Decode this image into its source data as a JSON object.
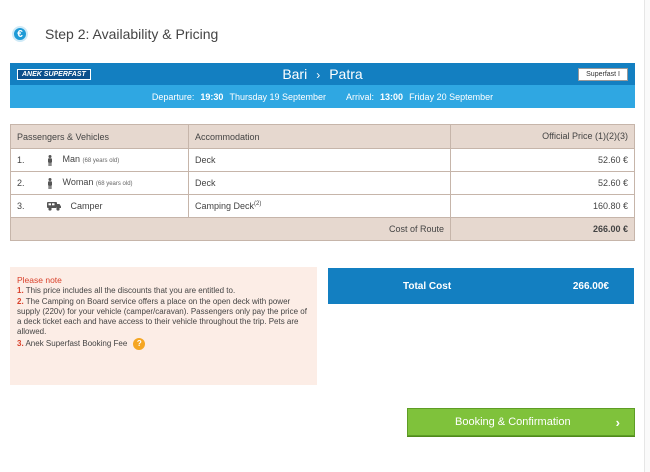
{
  "step": {
    "badge_icon": "euro-icon",
    "badge_symbol": "€",
    "title": "Step 2: Availability & Pricing"
  },
  "route": {
    "operator_logo": "ANEK SUPERFAST",
    "from": "Bari",
    "arrow": "›",
    "to": "Patra",
    "vessel": "Superfast I",
    "departure_label": "Departure:",
    "departure_time": "19:30",
    "departure_date": "Thursday 19 September",
    "arrival_label": "Arrival:",
    "arrival_time": "13:00",
    "arrival_date": "Friday 20 September"
  },
  "table": {
    "headers": {
      "passengers": "Passengers & Vehicles",
      "accommodation": "Accommodation",
      "price": "Official Price (1)(2)(3)"
    },
    "rows": [
      {
        "num": "1.",
        "icon": "person-icon",
        "name": "Man",
        "age": "(68 years old)",
        "accommodation": "Deck",
        "acc_sup": "",
        "price": "52.60 €"
      },
      {
        "num": "2.",
        "icon": "person-icon",
        "name": "Woman",
        "age": "(68 years old)",
        "accommodation": "Deck",
        "acc_sup": "",
        "price": "52.60 €"
      },
      {
        "num": "3.",
        "icon": "camper-icon",
        "name": "Camper",
        "age": "",
        "accommodation": "Camping Deck",
        "acc_sup": "(2)",
        "price": "160.80 €"
      }
    ],
    "cost_label": "Cost of Route",
    "cost_value": "266.00 €"
  },
  "note": {
    "heading": "Please note",
    "items": [
      {
        "num": "1.",
        "text": " This price includes all the discounts that you are entitled to."
      },
      {
        "num": "2.",
        "text": " The Camping on Board service offers a place on the open deck with power supply (220v) for your vehicle (camper/caravan). Passengers only pay the price of a deck ticket each and have access to their vehicle throughout the trip. Pets are allowed."
      },
      {
        "num": "3.",
        "text": " Anek Superfast Booking Fee"
      }
    ],
    "help_symbol": "?"
  },
  "total": {
    "label": "Total Cost",
    "value": "266.00€"
  },
  "booking": {
    "label": "Booking & Confirmation",
    "chevron": "›"
  },
  "colors": {
    "primary_blue": "#137fc1",
    "light_blue": "#2fa7e2",
    "table_header": "#e6d8cf",
    "note_bg": "#fcede6",
    "alert_red": "#d9412b",
    "book_green": "#7fc23b"
  }
}
